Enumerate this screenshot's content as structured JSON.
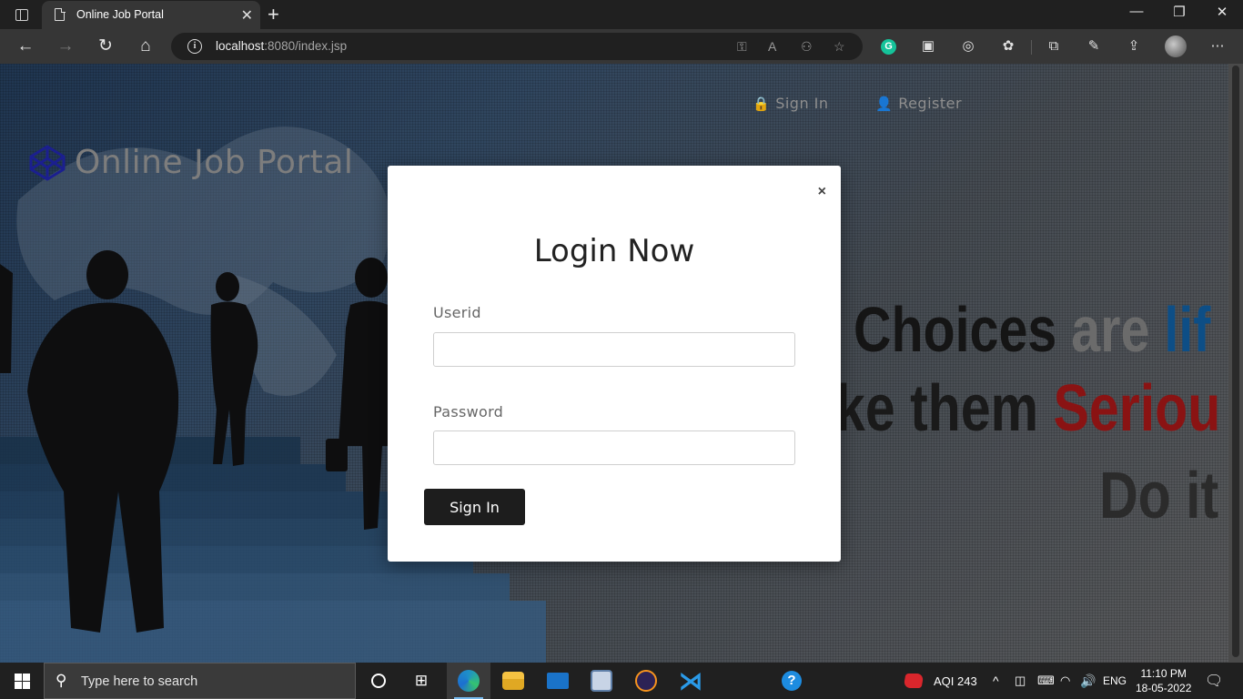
{
  "browser": {
    "tab_title": "Online Job Portal",
    "url_host": "localhost",
    "url_rest": ":8080/index.jsp"
  },
  "site": {
    "brand": "Online Job Portal",
    "nav": {
      "signin_label": "Sign In",
      "register_label": "Register"
    },
    "hero": {
      "line1_a": "Choices",
      "line1_b": "are",
      "line1_c": "lif",
      "line2_a": "ke them",
      "line2_b": "Seriou",
      "line3": "Do it"
    }
  },
  "modal": {
    "close": "×",
    "title": "Login Now",
    "userid_label": "Userid",
    "password_label": "Password",
    "submit_label": "Sign In"
  },
  "taskbar": {
    "search_placeholder": "Type here to search",
    "aqi": "AQI 243",
    "lang": "ENG",
    "time": "11:10 PM",
    "date": "18-05-2022"
  },
  "colors": {
    "brand_logo": "#1b1f8f",
    "hero_blue": "#0d4e86",
    "hero_red": "#8a1313",
    "hero_dark": "#151515",
    "edge_accent": "#76b9ed"
  }
}
